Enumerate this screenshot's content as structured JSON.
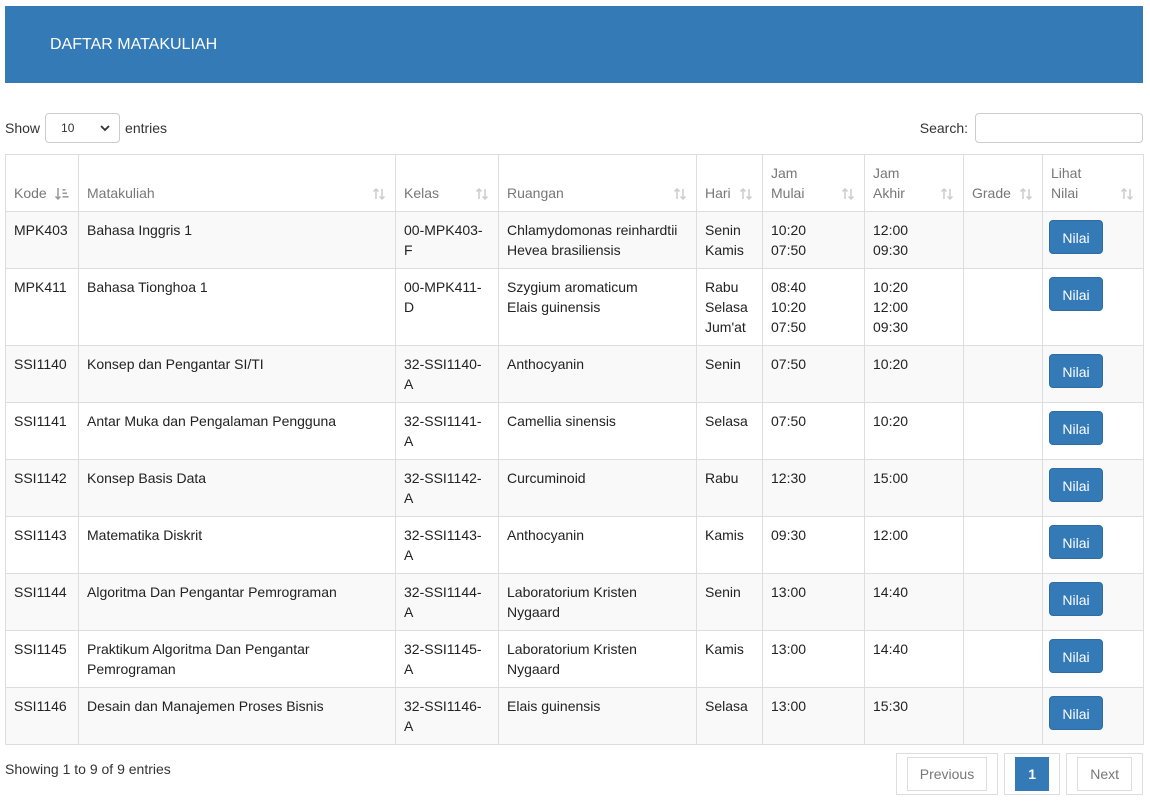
{
  "header": {
    "title": "DAFTAR MATAKULIAH"
  },
  "controls": {
    "show_label": "Show",
    "length_value": "10",
    "entries_label": "entries",
    "search_label": "Search:",
    "search_value": ""
  },
  "table": {
    "columns": [
      {
        "line1": "",
        "line2": "Kode"
      },
      {
        "line1": "",
        "line2": "Matakuliah"
      },
      {
        "line1": "",
        "line2": "Kelas"
      },
      {
        "line1": "",
        "line2": "Ruangan"
      },
      {
        "line1": "",
        "line2": "Hari"
      },
      {
        "line1": "Jam",
        "line2": "Mulai"
      },
      {
        "line1": "Jam",
        "line2": "Akhir"
      },
      {
        "line1": "",
        "line2": "Grade"
      },
      {
        "line1": "Lihat",
        "line2": "Nilai"
      }
    ],
    "button_label": "Nilai",
    "rows": [
      {
        "kode": "MPK403",
        "matakuliah": "Bahasa Inggris 1",
        "kelas": "00-MPK403-F",
        "ruangan": [
          "Chlamydomonas reinhardtii",
          "Hevea brasiliensis"
        ],
        "hari": [
          "Senin",
          "Kamis"
        ],
        "mulai": [
          "10:20",
          "07:50"
        ],
        "akhir": [
          "12:00",
          "09:30"
        ],
        "grade": ""
      },
      {
        "kode": "MPK411",
        "matakuliah": "Bahasa Tionghoa 1",
        "kelas": "00-MPK411-D",
        "ruangan": [
          "Szygium aromaticum",
          "Elais guinensis"
        ],
        "hari": [
          "Rabu",
          "Selasa",
          "Jum'at"
        ],
        "mulai": [
          "08:40",
          "10:20",
          "07:50"
        ],
        "akhir": [
          "10:20",
          "12:00",
          "09:30"
        ],
        "grade": ""
      },
      {
        "kode": "SSI1140",
        "matakuliah": "Konsep dan Pengantar SI/TI",
        "kelas": "32-SSI1140-A",
        "ruangan": [
          "Anthocyanin"
        ],
        "hari": [
          "Senin"
        ],
        "mulai": [
          "07:50"
        ],
        "akhir": [
          "10:20"
        ],
        "grade": ""
      },
      {
        "kode": "SSI1141",
        "matakuliah": "Antar Muka dan Pengalaman Pengguna",
        "kelas": "32-SSI1141-A",
        "ruangan": [
          "Camellia sinensis"
        ],
        "hari": [
          "Selasa"
        ],
        "mulai": [
          "07:50"
        ],
        "akhir": [
          "10:20"
        ],
        "grade": ""
      },
      {
        "kode": "SSI1142",
        "matakuliah": "Konsep Basis Data",
        "kelas": "32-SSI1142-A",
        "ruangan": [
          "Curcuminoid"
        ],
        "hari": [
          "Rabu"
        ],
        "mulai": [
          "12:30"
        ],
        "akhir": [
          "15:00"
        ],
        "grade": ""
      },
      {
        "kode": "SSI1143",
        "matakuliah": "Matematika Diskrit",
        "kelas": "32-SSI1143-A",
        "ruangan": [
          "Anthocyanin"
        ],
        "hari": [
          "Kamis"
        ],
        "mulai": [
          "09:30"
        ],
        "akhir": [
          "12:00"
        ],
        "grade": ""
      },
      {
        "kode": "SSI1144",
        "matakuliah": "Algoritma Dan Pengantar Pemrograman",
        "kelas": "32-SSI1144-A",
        "ruangan": [
          "Laboratorium Kristen Nygaard"
        ],
        "hari": [
          "Senin"
        ],
        "mulai": [
          "13:00"
        ],
        "akhir": [
          "14:40"
        ],
        "grade": ""
      },
      {
        "kode": "SSI1145",
        "matakuliah": "Praktikum Algoritma Dan Pengantar Pemrograman",
        "kelas": "32-SSI1145-A",
        "ruangan": [
          "Laboratorium Kristen Nygaard"
        ],
        "hari": [
          "Kamis"
        ],
        "mulai": [
          "13:00"
        ],
        "akhir": [
          "14:40"
        ],
        "grade": ""
      },
      {
        "kode": "SSI1146",
        "matakuliah": "Desain dan Manajemen Proses Bisnis",
        "kelas": "32-SSI1146-A",
        "ruangan": [
          "Elais guinensis"
        ],
        "hari": [
          "Selasa"
        ],
        "mulai": [
          "13:00"
        ],
        "akhir": [
          "15:30"
        ],
        "grade": ""
      }
    ]
  },
  "footer": {
    "info": "Showing 1 to 9 of 9 entries",
    "previous": "Previous",
    "page": "1",
    "next": "Next"
  },
  "colors": {
    "primary": "#337ab7",
    "border": "#dddddd",
    "stripe": "#f9f9f9"
  },
  "icons": {
    "sort_active": "sort-amount-asc-icon",
    "sort": "sort-both-icon",
    "dropdown": "chevron-down-icon"
  }
}
